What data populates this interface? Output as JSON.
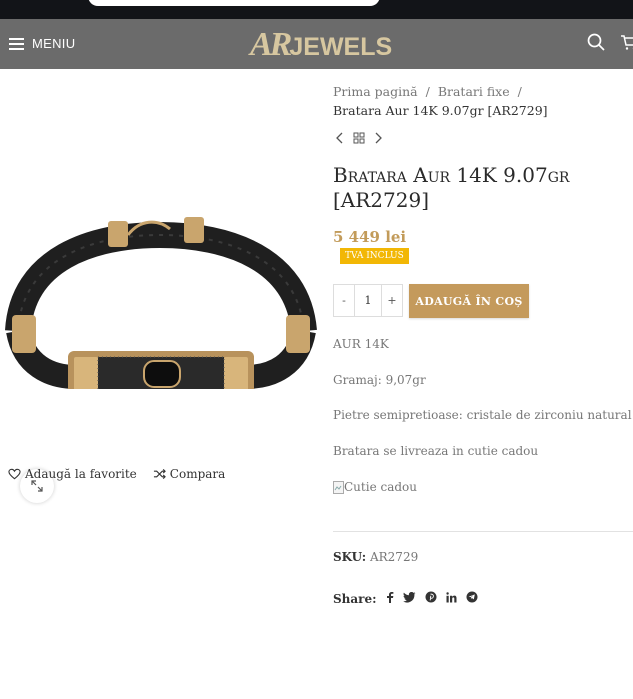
{
  "header": {
    "menu_label": "MENIU",
    "logo_part1": "AR",
    "logo_part2": "JEWELS"
  },
  "breadcrumb": {
    "home": "Prima pagină",
    "category": "Bratari fixe",
    "current": "Bratara Aur 14K 9.07gr [AR2729]",
    "separator": "/"
  },
  "product": {
    "title": "Bratara Aur 14K 9.07gr [AR2729]",
    "price": "5 449 lei",
    "tax_badge": "TVA INCLUS",
    "quantity": "1",
    "qty_minus": "-",
    "qty_plus": "+",
    "add_to_cart": "ADAUGĂ ÎN COȘ",
    "description": [
      "AUR 14K",
      "Gramaj: 9,07gr",
      "Pietre semipretioase: cristale de zirconiu natural",
      "Bratara se livreaza in cutie cadou"
    ],
    "image_alt": "Cutie cadou",
    "sku_label": "SKU:",
    "sku_value": "AR2729",
    "share_label": "Share:"
  },
  "gallery_actions": {
    "wishlist": "Adaugă la favorite",
    "compare": "Compara"
  },
  "colors": {
    "accent": "#c49a5c",
    "price": "#c29b5a",
    "badge": "#f2b705",
    "header_bg": "#6b6b6b",
    "logo": "#d7c7a0"
  },
  "icons": [
    "hamburger-icon",
    "search-icon",
    "cart-icon",
    "expand-icon",
    "heart-icon",
    "shuffle-icon",
    "chevron-left-icon",
    "grid-icon",
    "chevron-right-icon",
    "facebook-icon",
    "twitter-icon",
    "pinterest-icon",
    "linkedin-icon",
    "telegram-icon",
    "broken-image-icon"
  ]
}
